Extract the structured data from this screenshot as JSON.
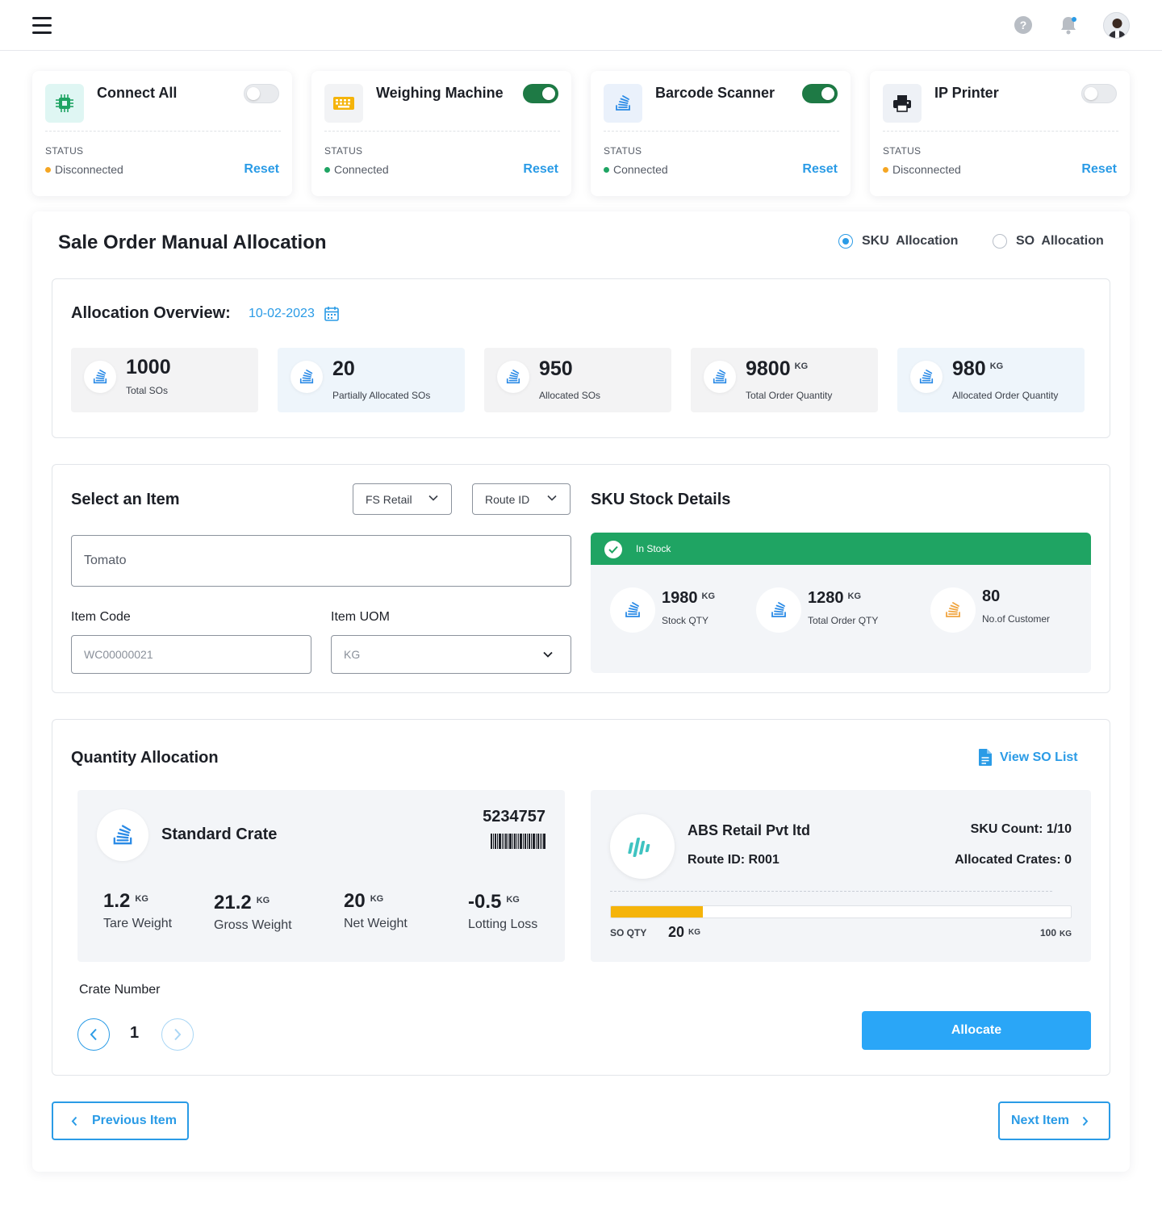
{
  "topbar": {
    "help_icon": "help-icon",
    "bell_icon": "bell-icon",
    "avatar_icon": "user-avatar"
  },
  "devices": [
    {
      "name": "Connect All",
      "status_label": "STATUS",
      "status": "Disconnected",
      "status_color": "#f5a623",
      "enabled": false,
      "reset": "Reset",
      "icon": "chip-icon"
    },
    {
      "name": "Weighing Machine",
      "status_label": "STATUS",
      "status": "Connected",
      "status_color": "#1fa463",
      "enabled": true,
      "reset": "Reset",
      "icon": "keyboard-icon"
    },
    {
      "name": "Barcode Scanner",
      "status_label": "STATUS",
      "status": "Connected",
      "status_color": "#1fa463",
      "enabled": true,
      "reset": "Reset",
      "icon": "stack-icon"
    },
    {
      "name": "IP Printer",
      "status_label": "STATUS",
      "status": "Disconnected",
      "status_color": "#f5a623",
      "enabled": false,
      "reset": "Reset",
      "icon": "printer-icon"
    }
  ],
  "page": {
    "title": "Sale Order Manual Allocation",
    "allocation_modes": [
      {
        "label": "SKU  Allocation",
        "selected": true
      },
      {
        "label": "SO  Allocation",
        "selected": false
      }
    ]
  },
  "overview": {
    "title": "Allocation Overview:",
    "date": "10-02-2023",
    "stats": [
      {
        "value": "1000",
        "unit": "",
        "label": "Total SOs"
      },
      {
        "value": "20",
        "unit": "",
        "label": "Partially Allocated SOs"
      },
      {
        "value": "950",
        "unit": "",
        "label": "Allocated SOs"
      },
      {
        "value": "9800",
        "unit": "KG",
        "label": "Total Order Quantity"
      },
      {
        "value": "980",
        "unit": "KG",
        "label": "Allocated Order Quantity"
      }
    ]
  },
  "item_select": {
    "title": "Select an Item",
    "filter_channel": "FS Retail",
    "filter_route": "Route ID",
    "item_name": "Tomato",
    "item_code_label": "Item Code",
    "item_code": "WC00000021",
    "uom_label": "Item UOM",
    "uom": "KG"
  },
  "sku_stock": {
    "title": "SKU Stock Details",
    "status": "In Stock",
    "items": [
      {
        "value": "1980",
        "unit": "KG",
        "label": "Stock QTY"
      },
      {
        "value": "1280",
        "unit": "KG",
        "label": "Total Order QTY"
      },
      {
        "value": "80",
        "unit": "",
        "label": "No.of Customer"
      }
    ]
  },
  "quantity_allocation": {
    "title": "Quantity Allocation",
    "view_so_list": "View SO List",
    "crate": {
      "name": "Standard Crate",
      "code": "5234757",
      "weights": [
        {
          "value": "1.2",
          "unit": "KG",
          "label": "Tare Weight"
        },
        {
          "value": "21.2",
          "unit": "KG",
          "label": "Gross Weight"
        },
        {
          "value": "20",
          "unit": "KG",
          "label": "Net Weight"
        },
        {
          "value": "-0.5",
          "unit": "KG",
          "label": "Lotting Loss"
        }
      ]
    },
    "customer": {
      "name": "ABS Retail Pvt ltd",
      "route": "Route ID: R001",
      "sku_count": "SKU Count: 1/10",
      "allocated_crates": "Allocated Crates: 0",
      "so_qty_label": "SO QTY",
      "so_qty": "20",
      "so_qty_unit": "KG",
      "so_max": "100",
      "so_max_unit": "KG",
      "progress_fraction": 0.2,
      "progress_color": "#f5b40b"
    },
    "crate_number_label": "Crate Number",
    "crate_number": "1",
    "allocate": "Allocate"
  },
  "footer": {
    "previous": "Previous Item",
    "next": "Next Item"
  },
  "colors": {
    "accent": "#2a9be6",
    "success": "#1fa463",
    "warning": "#f5a623",
    "toggle_on": "#1e7a45"
  }
}
